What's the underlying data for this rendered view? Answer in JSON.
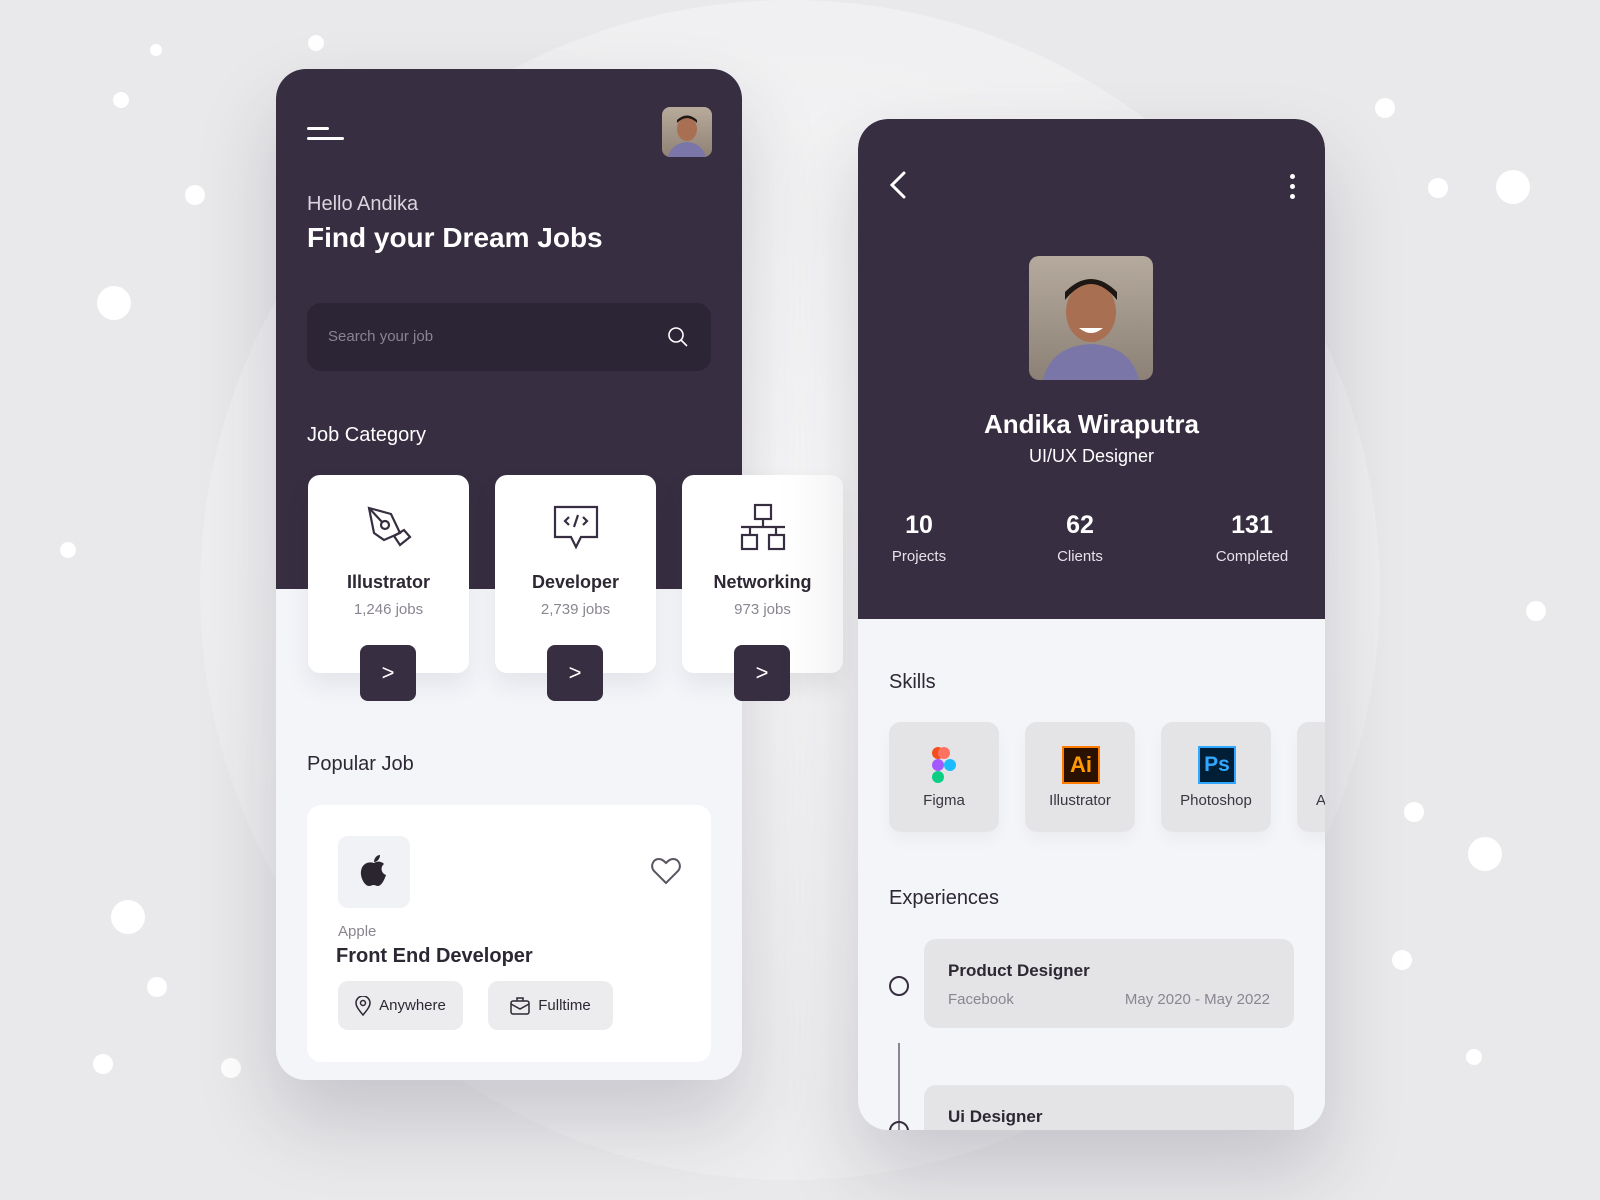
{
  "home": {
    "greeting": "Hello Andika",
    "headline": "Find your Dream Jobs",
    "search_placeholder": "Search your job",
    "category_heading": "Job Category",
    "categories": [
      {
        "name": "Illustrator",
        "count": "1,246 jobs",
        "icon": "pen-tool-icon"
      },
      {
        "name": "Developer",
        "count": "2,739 jobs",
        "icon": "code-icon"
      },
      {
        "name": "Networking",
        "count": "973 jobs",
        "icon": "network-icon"
      }
    ],
    "arrow_label": ">",
    "popular_heading": "Popular Job",
    "popular_job": {
      "company": "Apple",
      "title": "Front End Developer",
      "location": "Anywhere",
      "type": "Fulltime"
    }
  },
  "profile": {
    "name": "Andika Wiraputra",
    "role": "UI/UX Designer",
    "stats": [
      {
        "value": "10",
        "label": "Projects"
      },
      {
        "value": "62",
        "label": "Clients"
      },
      {
        "value": "131",
        "label": "Completed"
      }
    ],
    "skills_heading": "Skills",
    "skills": [
      {
        "name": "Figma"
      },
      {
        "name": "Illustrator",
        "icon_text": "Ai"
      },
      {
        "name": "Photoshop",
        "icon_text": "Ps"
      },
      {
        "name": "A"
      }
    ],
    "experiences_heading": "Experiences",
    "experiences": [
      {
        "title": "Product Designer",
        "company": "Facebook",
        "dates": "May 2020 - May 2022"
      },
      {
        "title": "Ui Designer"
      }
    ]
  },
  "colors": {
    "primary": "#372e41",
    "background": "#f4f5f9"
  }
}
